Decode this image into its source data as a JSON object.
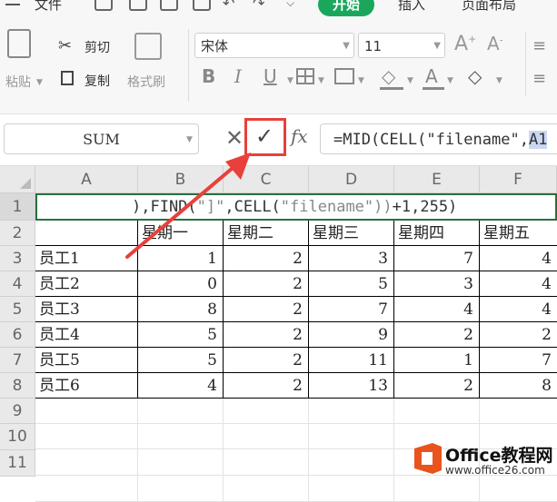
{
  "menu": {
    "file": "文件",
    "home": "开始",
    "insert": "插入",
    "page_layout": "页面布局"
  },
  "clipboard": {
    "paste": "粘贴",
    "cut": "剪切",
    "copy": "复制",
    "format_painter": "格式刷"
  },
  "font": {
    "name": "宋体",
    "size": "11"
  },
  "formula_bar": {
    "name_box": "SUM",
    "fx": "fx",
    "formula_prefix": "=MID(CELL(\"filename\",",
    "formula_highlight": "A1"
  },
  "columns": [
    "A",
    "B",
    "C",
    "D",
    "E",
    "F"
  ],
  "rows": [
    "1",
    "2",
    "3",
    "4",
    "5",
    "6",
    "7",
    "8",
    "9",
    "10",
    "11"
  ],
  "edit_cell_text": {
    "p1": "),FIND(",
    "p2": "\"]\"",
    "p3": ",CELL(",
    "p4": "\"filename\"",
    "p5": "))",
    "p6": "+1,255)"
  },
  "table": {
    "header": [
      "",
      "星期一",
      "星期二",
      "星期三",
      "星期四",
      "星期五"
    ],
    "data": [
      [
        "员工1",
        "1",
        "2",
        "3",
        "7",
        "4"
      ],
      [
        "员工2",
        "0",
        "2",
        "5",
        "3",
        "4"
      ],
      [
        "员工3",
        "8",
        "2",
        "7",
        "4",
        "4"
      ],
      [
        "员工4",
        "5",
        "2",
        "9",
        "2",
        "2"
      ],
      [
        "员工5",
        "5",
        "2",
        "11",
        "1",
        "7"
      ],
      [
        "员工6",
        "4",
        "2",
        "13",
        "2",
        "8"
      ]
    ]
  },
  "logo": {
    "name": "Office教程网",
    "url": "www.office26.com"
  },
  "colors": {
    "accent_green": "#1aa75c",
    "annotation_red": "#e8403a",
    "logo_orange": "#e8541c"
  }
}
